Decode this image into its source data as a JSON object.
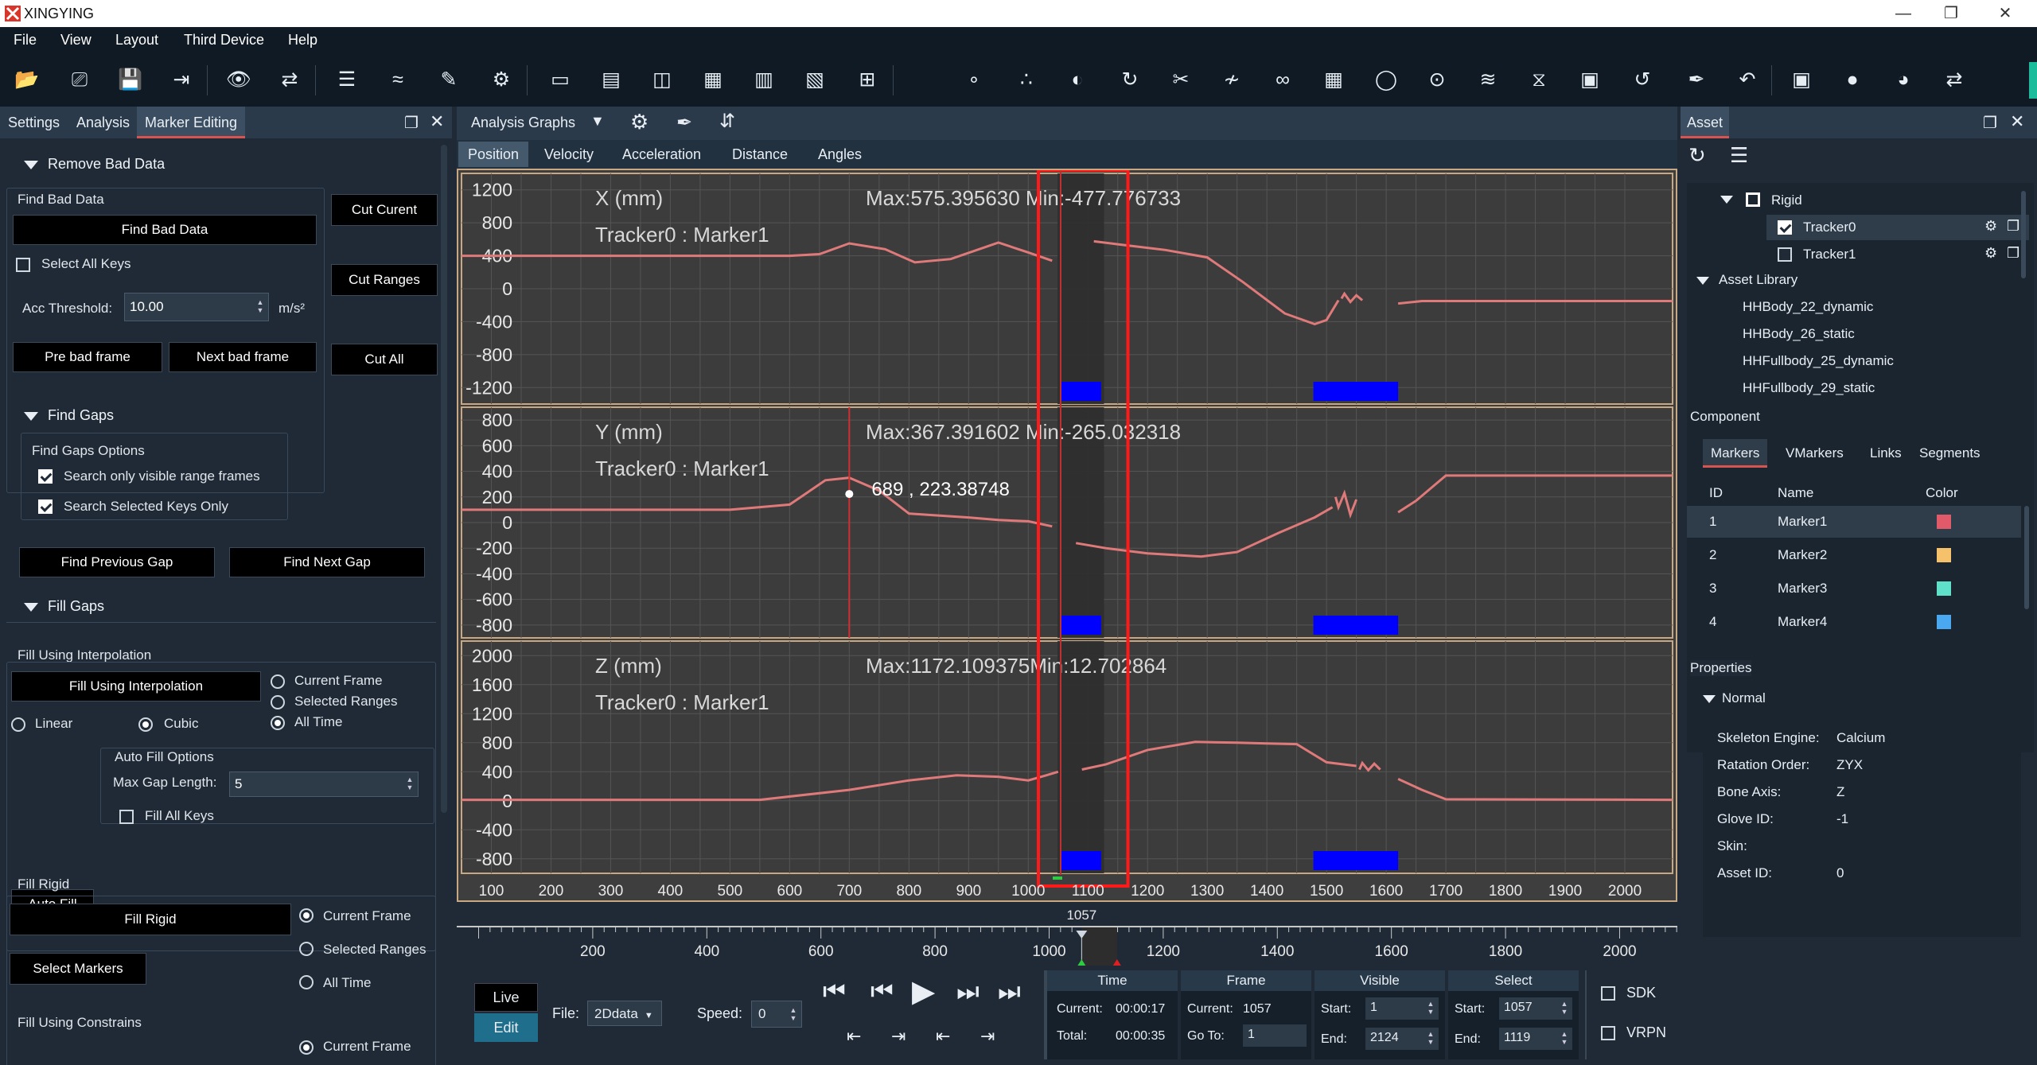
{
  "app": {
    "title": "XINGYING"
  },
  "menu": [
    "File",
    "View",
    "Layout",
    "Third Device",
    "Help"
  ],
  "left_panel": {
    "tabs": [
      "Settings",
      "Analysis",
      "Marker Editing"
    ],
    "remove_bad_data": {
      "header": "Remove Bad Data",
      "group": "Find Bad Data",
      "find_bad_data": "Find Bad Data",
      "select_all_keys": "Select All Keys",
      "acc_threshold_label": "Acc Threshold:",
      "acc_threshold_value": "10.00",
      "acc_unit": "m/s²",
      "pre_bad_frame": "Pre bad frame",
      "next_bad_frame": "Next bad frame",
      "cut_current": "Cut Curent",
      "cut_ranges": "Cut Ranges",
      "cut_all": "Cut All"
    },
    "find_gaps": {
      "header": "Find Gaps",
      "group": "Find Gaps Options",
      "opt1": "Search only visible range frames",
      "opt2": "Search Selected Keys Only",
      "prev": "Find Previous Gap",
      "next": "Find Next Gap"
    },
    "fill_gaps": {
      "header": "Fill Gaps",
      "interp_group": "Fill Using Interpolation",
      "interp_button": "Fill Using Interpolation",
      "current_frame": "Current Frame",
      "selected_ranges": "Selected Ranges",
      "all_time": "All Time",
      "linear": "Linear",
      "cubic": "Cubic",
      "auto_fill_group": "Auto Fill Options",
      "auto_fill": "Auto Fill",
      "max_gap_label": "Max Gap Length:",
      "max_gap_value": "5",
      "fill_all_keys": "Fill All Keys",
      "rigid_group": "Fill Rigid",
      "fill_rigid": "Fill Rigid",
      "select_markers": "Select Markers",
      "r_current_frame": "Current Frame",
      "r_selected_ranges": "Selected Ranges",
      "r_all_time": "All Time",
      "constrains_group": "Fill Using Constrains",
      "c_current_frame": "Current Frame"
    }
  },
  "graph_panel": {
    "title": "Analysis Graphs",
    "tabs": [
      "Position",
      "Velocity",
      "Acceleration",
      "Distance",
      "Angles"
    ],
    "x_ticks": [
      "100",
      "200",
      "300",
      "400",
      "500",
      "600",
      "700",
      "800",
      "900",
      "1000",
      "1100",
      "1200",
      "1300",
      "1400",
      "1500",
      "1600",
      "1700",
      "1800",
      "1900",
      "2000"
    ],
    "plots": [
      {
        "axis": "X (mm)",
        "subtitle": "Tracker0 : Marker1",
        "max_min": "Max:575.395630  Min:-477.776733",
        "y_ticks": [
          "1200",
          "800",
          "400",
          "0",
          "-400",
          "-800",
          "-1200"
        ]
      },
      {
        "axis": "Y (mm)",
        "subtitle": "Tracker0 : Marker1",
        "max_min": "Max:367.391602  Min:-265.032318",
        "y_ticks": [
          "800",
          "600",
          "400",
          "200",
          "0",
          "-200",
          "-400",
          "-600",
          "-800"
        ],
        "cursor_label": "689 , 223.38748"
      },
      {
        "axis": "Z (mm)",
        "subtitle": "Tracker0 : Marker1",
        "max_min": "Max:1172.109375Min:12.702864",
        "y_ticks": [
          "2000",
          "1600",
          "1200",
          "800",
          "400",
          "0",
          "-400",
          "-800"
        ]
      }
    ]
  },
  "chart_data": [
    {
      "type": "line",
      "title": "X (mm)",
      "subtitle": "Tracker0 : Marker1",
      "xlabel": "",
      "ylabel": "X (mm)",
      "xlim": [
        50,
        2080
      ],
      "ylim": [
        -1400,
        1400
      ],
      "series": [
        {
          "name": "Tracker0 : Marker1",
          "color": "#e07a7a",
          "segments": [
            [
              [
                50,
                400
              ],
              [
                250,
                400
              ],
              [
                450,
                400
              ],
              [
                600,
                400
              ],
              [
                650,
                420
              ],
              [
                700,
                550
              ],
              [
                760,
                480
              ],
              [
                810,
                320
              ],
              [
                870,
                360
              ],
              [
                950,
                560
              ],
              [
                1000,
                440
              ],
              [
                1040,
                340
              ]
            ],
            [
              [
                1110,
                575
              ],
              [
                1150,
                540
              ],
              [
                1230,
                470
              ],
              [
                1300,
                380
              ],
              [
                1360,
                80
              ],
              [
                1430,
                -300
              ],
              [
                1480,
                -430
              ],
              [
                1500,
                -380
              ],
              [
                1520,
                -140
              ]
            ],
            [
              [
                1525,
                -120
              ],
              [
                1530,
                -60
              ],
              [
                1540,
                -160
              ],
              [
                1550,
                -80
              ],
              [
                1560,
                -140
              ]
            ],
            [
              [
                1620,
                -180
              ],
              [
                1660,
                -150
              ],
              [
                1800,
                -150
              ],
              [
                2080,
                -150
              ]
            ]
          ]
        }
      ]
    },
    {
      "type": "line",
      "title": "Y (mm)",
      "subtitle": "Tracker0 : Marker1",
      "xlabel": "",
      "ylabel": "Y (mm)",
      "xlim": [
        50,
        2080
      ],
      "ylim": [
        -900,
        900
      ],
      "series": [
        {
          "name": "Tracker0 : Marker1",
          "color": "#e07a7a",
          "segments": [
            [
              [
                50,
                100
              ],
              [
                300,
                100
              ],
              [
                500,
                100
              ],
              [
                600,
                140
              ],
              [
                660,
                330
              ],
              [
                700,
                350
              ],
              [
                750,
                250
              ],
              [
                800,
                70
              ],
              [
                900,
                40
              ],
              [
                950,
                20
              ],
              [
                1000,
                10
              ],
              [
                1040,
                -30
              ]
            ],
            [
              [
                1080,
                -160
              ],
              [
                1130,
                -200
              ],
              [
                1200,
                -240
              ],
              [
                1290,
                -265
              ],
              [
                1350,
                -230
              ],
              [
                1420,
                -80
              ],
              [
                1480,
                40
              ],
              [
                1510,
                120
              ]
            ],
            [
              [
                1515,
                200
              ],
              [
                1520,
                120
              ],
              [
                1530,
                230
              ],
              [
                1540,
                60
              ],
              [
                1550,
                180
              ]
            ],
            [
              [
                1620,
                80
              ],
              [
                1650,
                170
              ],
              [
                1700,
                367
              ],
              [
                2080,
                367
              ]
            ]
          ]
        }
      ]
    },
    {
      "type": "line",
      "title": "Z (mm)",
      "subtitle": "Tracker0 : Marker1",
      "xlabel": "",
      "ylabel": "Z (mm)",
      "xlim": [
        50,
        2080
      ],
      "ylim": [
        -1000,
        2200
      ],
      "series": [
        {
          "name": "Tracker0 : Marker1",
          "color": "#e07a7a",
          "segments": [
            [
              [
                50,
                13
              ],
              [
                350,
                13
              ],
              [
                550,
                13
              ],
              [
                700,
                150
              ],
              [
                800,
                280
              ],
              [
                880,
                350
              ],
              [
                950,
                330
              ],
              [
                1000,
                280
              ],
              [
                1030,
                350
              ],
              [
                1050,
                400
              ]
            ],
            [
              [
                1090,
                430
              ],
              [
                1130,
                500
              ],
              [
                1200,
                700
              ],
              [
                1280,
                810
              ],
              [
                1350,
                800
              ],
              [
                1400,
                790
              ],
              [
                1450,
                780
              ],
              [
                1500,
                530
              ],
              [
                1550,
                480
              ]
            ],
            [
              [
                1555,
                430
              ],
              [
                1560,
                520
              ],
              [
                1570,
                420
              ],
              [
                1580,
                510
              ],
              [
                1590,
                430
              ]
            ],
            [
              [
                1620,
                300
              ],
              [
                1660,
                150
              ],
              [
                1700,
                20
              ],
              [
                2080,
                13
              ]
            ]
          ]
        }
      ]
    }
  ],
  "timeline": {
    "current_label": "1057",
    "ticks": [
      "200",
      "400",
      "600",
      "800",
      "1000",
      "1200",
      "1400",
      "1600",
      "1800",
      "2000"
    ]
  },
  "bottom_controls": {
    "live": "Live",
    "edit": "Edit",
    "file_label": "File:",
    "file_value": "2Ddata",
    "speed_label": "Speed:",
    "speed_value": "0",
    "time": {
      "header": "Time",
      "current_label": "Current:",
      "current_value": "00:00:17",
      "total_label": "Total:",
      "total_value": "00:00:35"
    },
    "frame": {
      "header": "Frame",
      "current_label": "Current:",
      "current_value": "1057",
      "goto_label": "Go To:",
      "goto_value": "1"
    },
    "visible": {
      "header": "Visible",
      "start_label": "Start:",
      "start_value": "1",
      "end_label": "End:",
      "end_value": "2124"
    },
    "select": {
      "header": "Select",
      "start_label": "Start:",
      "start_value": "1057",
      "end_label": "End:",
      "end_value": "1119"
    },
    "sdk": "SDK",
    "vrpn": "VRPN"
  },
  "asset_panel": {
    "tab": "Asset",
    "tree": {
      "rigid": "Rigid",
      "tracker0": "Tracker0",
      "tracker1": "Tracker1",
      "library": "Asset Library",
      "items": [
        "HHBody_22_dynamic",
        "HHBody_26_static",
        "HHFullbody_25_dynamic",
        "HHFullbody_29_static"
      ]
    },
    "component_label": "Component",
    "component_tabs": [
      "Markers",
      "VMarkers",
      "Links",
      "Segments"
    ],
    "table_headers": [
      "ID",
      "Name",
      "Color"
    ],
    "markers": [
      {
        "id": "1",
        "name": "Marker1",
        "color": "#e05a6a"
      },
      {
        "id": "2",
        "name": "Marker2",
        "color": "#f5c26b"
      },
      {
        "id": "3",
        "name": "Marker3",
        "color": "#5fe0c8"
      },
      {
        "id": "4",
        "name": "Marker4",
        "color": "#4aa8f0"
      }
    ],
    "properties_label": "Properties",
    "normal_label": "Normal",
    "props": [
      {
        "k": "Skeleton Engine:",
        "v": "Calcium"
      },
      {
        "k": "Ratation Order:",
        "v": "ZYX"
      },
      {
        "k": "Bone Axis:",
        "v": "Z"
      },
      {
        "k": "Glove ID:",
        "v": "-1"
      },
      {
        "k": "Skin:",
        "v": ""
      },
      {
        "k": "Asset ID:",
        "v": "0"
      }
    ]
  }
}
